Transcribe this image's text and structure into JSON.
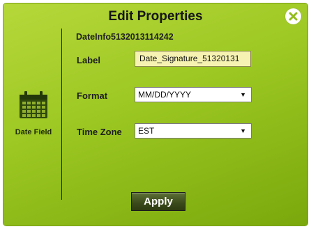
{
  "dialog": {
    "title": "Edit Properties",
    "close_icon": "close-icon",
    "accent_color": "#9cc722"
  },
  "sidebar": {
    "icon": "calendar-icon",
    "label": "Date Field"
  },
  "form": {
    "field_id": "DateInfo5132013114242",
    "label": {
      "caption": "Label",
      "value": "Date_Signature_51320131"
    },
    "format": {
      "caption": "Format",
      "selected": "MM/DD/YYYY"
    },
    "time_zone": {
      "caption": "Time Zone",
      "selected": "EST"
    }
  },
  "footer": {
    "apply_label": "Apply"
  }
}
